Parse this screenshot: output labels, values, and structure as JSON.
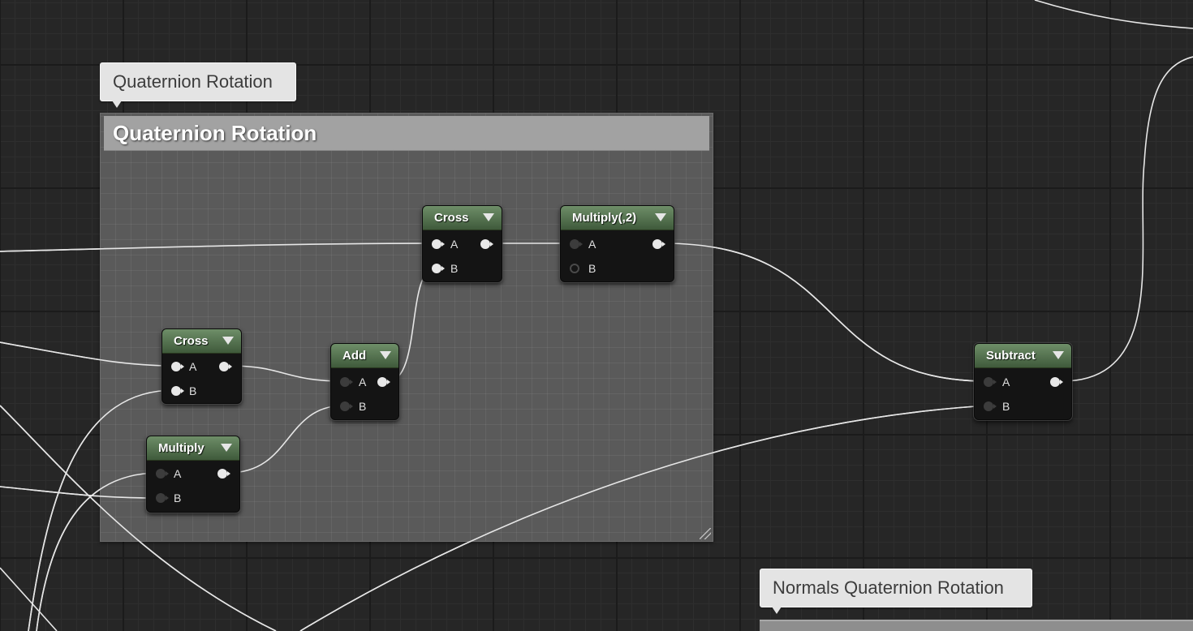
{
  "comments": {
    "main_bubble": "Quaternion Rotation",
    "main_header": "Quaternion Rotation",
    "bottom_bubble": "Normals Quaternion Rotation"
  },
  "nodes": {
    "cross_top": {
      "title": "Cross",
      "in_a": "A",
      "in_b": "B"
    },
    "multiply2": {
      "title": "Multiply(,2)",
      "in_a": "A",
      "in_b": "B"
    },
    "cross_left": {
      "title": "Cross",
      "in_a": "A",
      "in_b": "B"
    },
    "add": {
      "title": "Add",
      "in_a": "A",
      "in_b": "B"
    },
    "multiply": {
      "title": "Multiply",
      "in_a": "A",
      "in_b": "B"
    },
    "subtract": {
      "title": "Subtract",
      "in_a": "A",
      "in_b": "B"
    }
  },
  "colors": {
    "grid_background": "#262626",
    "comment_body": "#5a5a5a",
    "comment_header": "#a2a2a2",
    "node_header": "#5a7a55",
    "wire": "#e8e8e8"
  }
}
